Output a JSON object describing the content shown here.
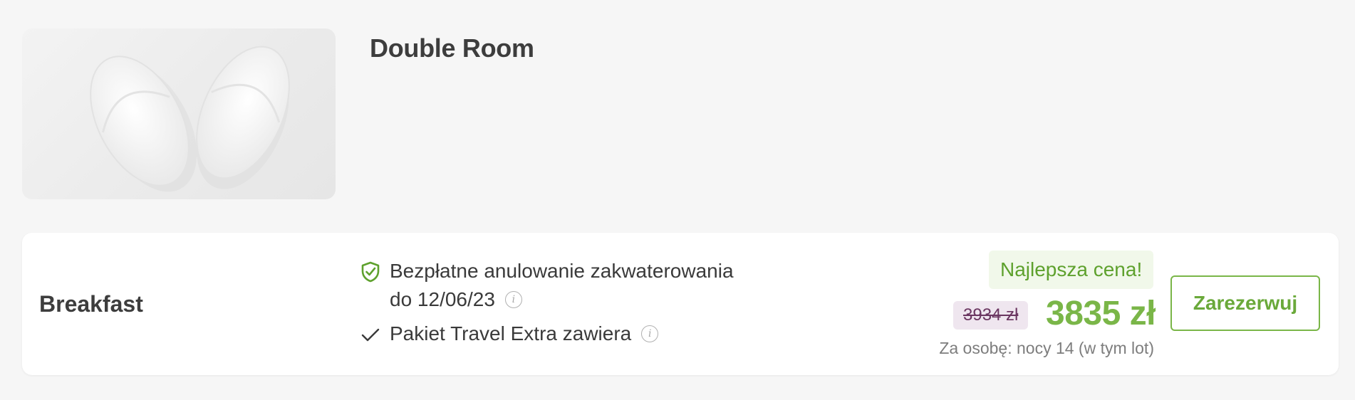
{
  "room": {
    "title": "Double Room",
    "image_icon": "slippers-photo"
  },
  "offer": {
    "board": "Breakfast",
    "benefits": [
      {
        "icon": "shield-check-icon",
        "text_line1": "Bezpłatne anulowanie zakwaterowania",
        "text_line2": "do 12/06/23",
        "has_info": true
      },
      {
        "icon": "check-icon",
        "text_line1": "Pakiet Travel Extra zawiera",
        "has_info": true
      }
    ],
    "badge": "Najlepsza cena!",
    "old_price": "3934 zł",
    "price": "3835 zł",
    "price_note": "Za osobę: nocy 14 (w tym lot)",
    "book_label": "Zarezerwuj",
    "info_symbol": "i"
  },
  "colors": {
    "accent_green": "#7ab648",
    "badge_bg": "#f1f8ea",
    "old_price_bg": "#efe6ef",
    "old_price_text": "#6a3560"
  }
}
